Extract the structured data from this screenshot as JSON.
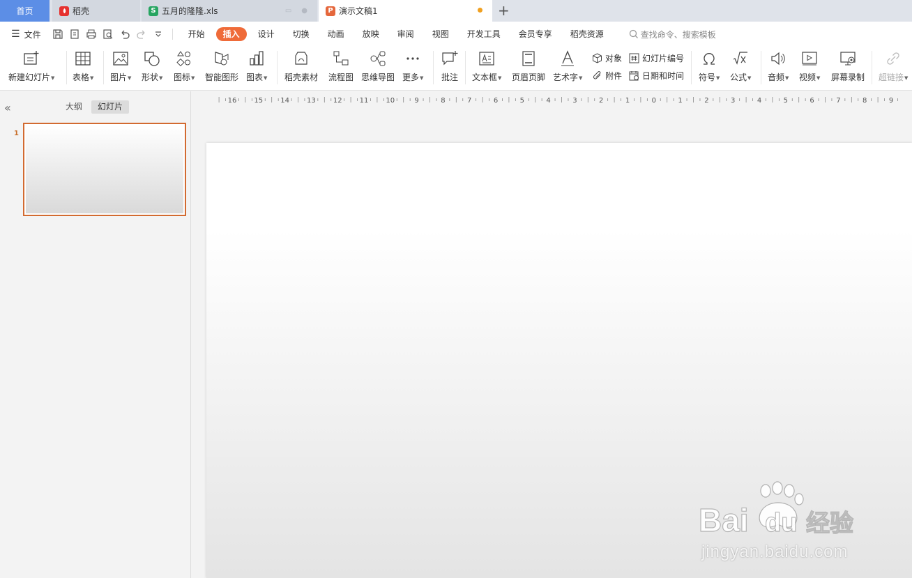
{
  "tabs": {
    "home": "首页",
    "docer": "稻壳",
    "xls": "五月的隆隆.xls",
    "ppt": "演示文稿1",
    "add": "+"
  },
  "menu": {
    "file": "文件",
    "items": [
      "开始",
      "插入",
      "设计",
      "切换",
      "动画",
      "放映",
      "审阅",
      "视图",
      "开发工具",
      "会员专享",
      "稻壳资源"
    ],
    "active": "插入",
    "search": "查找命令、搜索模板"
  },
  "ribbon": {
    "new_slide": "新建幻灯片",
    "table": "表格",
    "image": "图片",
    "shape": "形状",
    "icon": "图标",
    "smart_graphic": "智能图形",
    "chart": "图表",
    "docer_material": "稻壳素材",
    "flowchart": "流程图",
    "mindmap": "思维导图",
    "more": "更多",
    "comment": "批注",
    "textbox": "文本框",
    "header_footer": "页眉页脚",
    "wordart": "艺术字",
    "object": "对象",
    "attachment": "附件",
    "slide_number": "幻灯片编号",
    "date_time": "日期和时间",
    "symbol": "符号",
    "formula": "公式",
    "audio": "音频",
    "video": "视频",
    "screen_record": "屏幕录制",
    "hyperlink": "超链接"
  },
  "panel": {
    "outline": "大纲",
    "slides": "幻灯片",
    "slide_number": "1"
  },
  "ruler": {
    "labels": [
      "16",
      "15",
      "14",
      "13",
      "12",
      "11",
      "10",
      "9",
      "8",
      "7",
      "6",
      "5",
      "4",
      "3",
      "2",
      "1",
      "0",
      "1",
      "2",
      "3",
      "4",
      "5",
      "6",
      "7",
      "8",
      "9"
    ]
  },
  "watermark": {
    "text": "jingyan.baidu.com"
  },
  "colors": {
    "accent": "#ef6b39",
    "home_tab": "#5c8ee6",
    "selection": "#d26a30"
  }
}
